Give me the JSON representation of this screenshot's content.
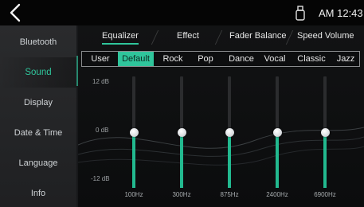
{
  "status": {
    "time": "AM 12:43"
  },
  "sidebar": {
    "items": [
      {
        "label": "Bluetooth",
        "active": false
      },
      {
        "label": "Sound",
        "active": true
      },
      {
        "label": "Display",
        "active": false
      },
      {
        "label": "Date & Time",
        "active": false
      },
      {
        "label": "Language",
        "active": false
      },
      {
        "label": "Info",
        "active": false
      }
    ]
  },
  "tabs": [
    {
      "label": "Equalizer",
      "active": true
    },
    {
      "label": "Effect",
      "active": false
    },
    {
      "label": "Fader Balance",
      "active": false
    },
    {
      "label": "Speed Volume",
      "active": false
    }
  ],
  "presets": [
    {
      "label": "User",
      "active": false
    },
    {
      "label": "Default",
      "active": true
    },
    {
      "label": "Rock",
      "active": false
    },
    {
      "label": "Pop",
      "active": false
    },
    {
      "label": "Dance",
      "active": false
    },
    {
      "label": "Vocal",
      "active": false
    },
    {
      "label": "Classic",
      "active": false
    },
    {
      "label": "Jazz",
      "active": false
    }
  ],
  "equalizer": {
    "scale": {
      "max_label": "12 dB",
      "mid_label": "0 dB",
      "min_label": "-12 dB",
      "max": 12,
      "min": -12
    },
    "bands": [
      {
        "freq": "100Hz",
        "gain_db": 0
      },
      {
        "freq": "300Hz",
        "gain_db": 0
      },
      {
        "freq": "875Hz",
        "gain_db": 0
      },
      {
        "freq": "2400Hz",
        "gain_db": 0
      },
      {
        "freq": "6900Hz",
        "gain_db": 0
      }
    ]
  },
  "colors": {
    "accent": "#2fc59b",
    "fill": "#22b98f"
  },
  "icons": {
    "back": "chevron-left-icon",
    "usb": "usb-icon"
  }
}
